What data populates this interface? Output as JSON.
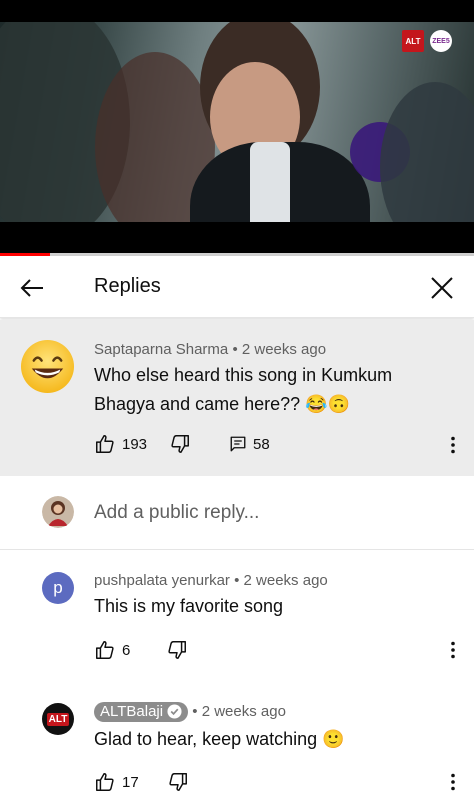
{
  "video": {
    "badge_alt": "ALT",
    "badge_zee5": "ZEE5",
    "progress_fraction": 0.105
  },
  "header": {
    "title": "Replies",
    "back_icon": "arrow-left-icon",
    "close_icon": "close-icon"
  },
  "parent_comment": {
    "author": "Saptaparna Sharma",
    "time": "2 weeks ago",
    "text": "Who else heard this song in Kumkum Bhagya and came here?? 😂🙃",
    "likes": "193",
    "replies": "58",
    "avatar_icon": "grinning-face-emoji"
  },
  "reply_box": {
    "placeholder": "Add a public reply..."
  },
  "replies": [
    {
      "author": "pushpalata yenurkar",
      "time": "2 weeks ago",
      "text": "This is my favorite song",
      "likes": "6",
      "avatar_letter": "p",
      "avatar_color": "#5c6bc0"
    },
    {
      "author": "ALTBalaji",
      "time": "2 weeks ago",
      "text": "Glad to hear, keep watching 🙂",
      "likes": "17",
      "avatar_text": "ALT",
      "verified": true
    }
  ],
  "colors": {
    "progress": "#ff0000",
    "highlight_bg": "#ececec",
    "meta_text": "#606060"
  }
}
